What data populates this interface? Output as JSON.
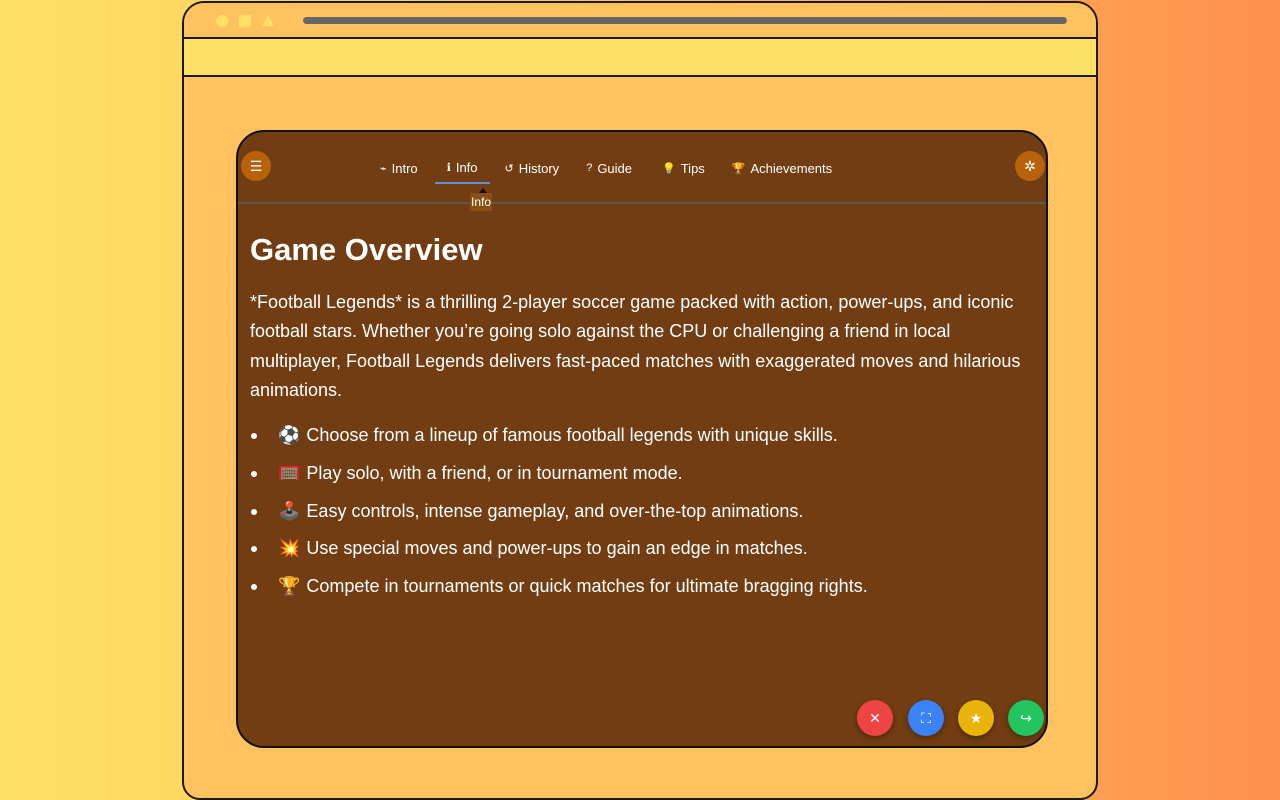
{
  "nav": {
    "tabs": [
      {
        "label": "Intro",
        "icon": "gamepad-icon",
        "glyph": "⌁"
      },
      {
        "label": "Info",
        "icon": "info-circle-icon",
        "glyph": "ℹ"
      },
      {
        "label": "History",
        "icon": "history-icon",
        "glyph": "↺"
      },
      {
        "label": "Guide",
        "icon": "question-circle-icon",
        "glyph": "?"
      },
      {
        "label": "Tips",
        "icon": "lightbulb-icon",
        "glyph": "💡"
      },
      {
        "label": "Achievements",
        "icon": "trophy-icon",
        "glyph": "🏆"
      }
    ],
    "active_tab": "Info",
    "tooltip": "Info"
  },
  "content": {
    "title": "Game Overview",
    "description": "*Football Legends* is a thrilling 2-player soccer game packed with action, power-ups, and iconic football stars. Whether you’re going solo against the CPU or challenging a friend in local multiplayer, Football Legends delivers fast-paced matches with exaggerated moves and hilarious animations.",
    "features": [
      {
        "emoji": "⚽",
        "text": "Choose from a lineup of famous football legends with unique skills."
      },
      {
        "emoji": "🥅",
        "text": "Play solo, with a friend, or in tournament mode."
      },
      {
        "emoji": "🕹️",
        "text": "Easy controls, intense gameplay, and over-the-top animations."
      },
      {
        "emoji": "💥",
        "text": "Use special moves and power-ups to gain an edge in matches."
      },
      {
        "emoji": "🏆",
        "text": "Compete in tournaments or quick matches for ultimate bragging rights."
      }
    ]
  },
  "icons": {
    "menu": "☰",
    "settings": "✲",
    "close": "✕",
    "fullscreen": "⛶",
    "star": "★",
    "share": "↪"
  },
  "colors": {
    "panel_bg": "#723d12",
    "active_tab_underline": "#5b93d6",
    "close": "#ef4444",
    "fullscreen": "#3b82f6",
    "star": "#eab308",
    "share": "#22c55e"
  }
}
